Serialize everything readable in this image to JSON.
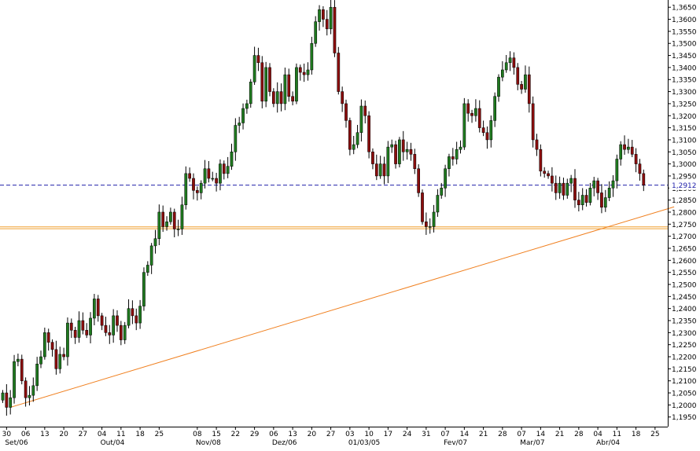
{
  "chart_data": {
    "type": "candlestick",
    "title": "",
    "xlabel": "",
    "ylabel": "",
    "ylim": [
      1.191,
      1.368
    ],
    "x_ticks": [
      {
        "label": "30",
        "i": 1
      },
      {
        "label": "06",
        "i": 6
      },
      {
        "label": "13",
        "i": 11
      },
      {
        "label": "20",
        "i": 16
      },
      {
        "label": "27",
        "i": 21
      },
      {
        "label": "04",
        "i": 26
      },
      {
        "label": "11",
        "i": 31
      },
      {
        "label": "18",
        "i": 36
      },
      {
        "label": "25",
        "i": 41
      },
      {
        "label": "08",
        "i": 51
      },
      {
        "label": "15",
        "i": 56
      },
      {
        "label": "22",
        "i": 61
      },
      {
        "label": "29",
        "i": 66
      },
      {
        "label": "06",
        "i": 71
      },
      {
        "label": "13",
        "i": 76
      },
      {
        "label": "20",
        "i": 81
      },
      {
        "label": "27",
        "i": 86
      },
      {
        "label": "03",
        "i": 91
      },
      {
        "label": "10",
        "i": 96
      },
      {
        "label": "17",
        "i": 101
      },
      {
        "label": "24",
        "i": 106
      },
      {
        "label": "31",
        "i": 111
      },
      {
        "label": "07",
        "i": 116
      },
      {
        "label": "14",
        "i": 121
      },
      {
        "label": "21",
        "i": 126
      },
      {
        "label": "28",
        "i": 131
      },
      {
        "label": "07",
        "i": 136
      },
      {
        "label": "14",
        "i": 141
      },
      {
        "label": "21",
        "i": 146
      },
      {
        "label": "28",
        "i": 151
      },
      {
        "label": "04",
        "i": 156
      },
      {
        "label": "11",
        "i": 161
      },
      {
        "label": "18",
        "i": 166
      },
      {
        "label": "25",
        "i": 171
      }
    ],
    "month_labels": [
      {
        "label": "Set/06",
        "i": 1
      },
      {
        "label": "Out/04",
        "i": 26
      },
      {
        "label": "Nov/08",
        "i": 51
      },
      {
        "label": "Dez/06",
        "i": 71
      },
      {
        "label": "01/03/05",
        "i": 91
      },
      {
        "label": "Fev/07",
        "i": 116
      },
      {
        "label": "Mar/07",
        "i": 136
      },
      {
        "label": "Abr/04",
        "i": 156
      }
    ],
    "y_ticks": [
      "1,3650",
      "1,3600",
      "1,3550",
      "1,3500",
      "1,3450",
      "1,3400",
      "1,3350",
      "1,3300",
      "1,3250",
      "1,3200",
      "1,3150",
      "1,3100",
      "1,3050",
      "1,3000",
      "1,2950",
      "1,2900",
      "1,2850",
      "1,2800",
      "1,2750",
      "1,2700",
      "1,2650",
      "1,2600",
      "1,2550",
      "1,2500",
      "1,2450",
      "1,2400",
      "1,2350",
      "1,2300",
      "1,2250",
      "1,2200",
      "1,2150",
      "1,2100",
      "1,2050",
      "1,2000",
      "1,1950"
    ],
    "current_price": {
      "value": 1.2912,
      "label": "1,2912",
      "color": "#2222aa"
    },
    "support_line": {
      "value": 1.2735,
      "color": "#f0a030"
    },
    "trendline": {
      "x1": 2,
      "y1": 1.199,
      "x2": 176,
      "y2": 1.2822,
      "color": "#f08020"
    },
    "colors": {
      "up": "#1f7a1f",
      "down": "#8b0d0d",
      "wick": "#000000"
    },
    "closes": [
      1.205,
      1.199,
      1.203,
      1.218,
      1.219,
      1.21,
      1.203,
      1.204,
      1.208,
      1.217,
      1.22,
      1.23,
      1.226,
      1.223,
      1.215,
      1.221,
      1.22,
      1.234,
      1.231,
      1.228,
      1.235,
      1.231,
      1.229,
      1.236,
      1.244,
      1.237,
      1.233,
      1.23,
      1.229,
      1.237,
      1.233,
      1.227,
      1.233,
      1.24,
      1.237,
      1.234,
      1.241,
      1.255,
      1.258,
      1.266,
      1.269,
      1.28,
      1.274,
      1.276,
      1.28,
      1.273,
      1.273,
      1.283,
      1.296,
      1.294,
      1.289,
      1.288,
      1.292,
      1.298,
      1.294,
      1.294,
      1.292,
      1.3,
      1.296,
      1.299,
      1.305,
      1.316,
      1.317,
      1.323,
      1.325,
      1.334,
      1.345,
      1.342,
      1.326,
      1.34,
      1.33,
      1.325,
      1.33,
      1.325,
      1.337,
      1.328,
      1.326,
      1.34,
      1.338,
      1.337,
      1.339,
      1.35,
      1.359,
      1.364,
      1.36,
      1.356,
      1.365,
      1.346,
      1.33,
      1.325,
      1.318,
      1.306,
      1.308,
      1.313,
      1.324,
      1.32,
      1.305,
      1.3,
      1.295,
      1.3,
      1.295,
      1.307,
      1.308,
      1.3,
      1.31,
      1.305,
      1.306,
      1.304,
      1.298,
      1.288,
      1.276,
      1.274,
      1.274,
      1.28,
      1.287,
      1.29,
      1.298,
      1.303,
      1.302,
      1.306,
      1.307,
      1.325,
      1.321,
      1.32,
      1.323,
      1.315,
      1.313,
      1.31,
      1.318,
      1.328,
      1.336,
      1.339,
      1.342,
      1.344,
      1.34,
      1.333,
      1.331,
      1.337,
      1.325,
      1.31,
      1.306,
      1.297,
      1.296,
      1.295,
      1.292,
      1.288,
      1.292,
      1.287,
      1.292,
      1.294,
      1.285,
      1.283,
      1.287,
      1.284,
      1.29,
      1.293,
      1.288,
      1.282,
      1.286,
      1.29,
      1.293,
      1.302,
      1.308,
      1.306,
      1.307,
      1.304,
      1.3,
      1.296,
      1.2912
    ]
  }
}
